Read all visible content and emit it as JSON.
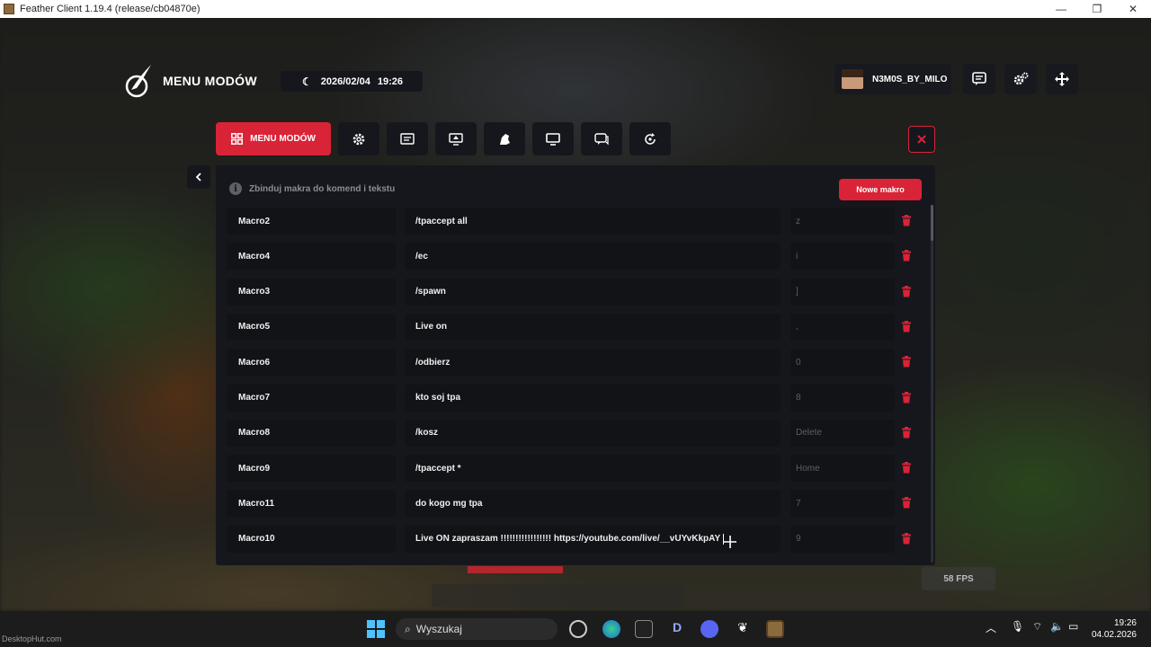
{
  "window": {
    "title": "Feather Client 1.19.4 (release/cb04870e)",
    "minimize": "—",
    "maximize": "❐",
    "close": "✕"
  },
  "header": {
    "brand": "MENU MODÓW",
    "date": "2026/02/04",
    "time": "19:26",
    "username": "N3M0S_BY_MILO"
  },
  "tabs": {
    "main_label": "MENU MODÓW",
    "icons": [
      "gear-icon",
      "text-icon",
      "screen-share-icon",
      "cosmetics-icon",
      "monitor-icon",
      "chat-icon",
      "refresh-icon"
    ]
  },
  "panel": {
    "info_text": "Zbinduj makra do komend i tekstu",
    "new_button": "Nowe makro",
    "macros": [
      {
        "name": "Macro2",
        "command": "/tpaccept all",
        "key": "z"
      },
      {
        "name": "Macro4",
        "command": "/ec",
        "key": "i"
      },
      {
        "name": "Macro3",
        "command": "/spawn",
        "key": "]"
      },
      {
        "name": "Macro5",
        "command": "Live on",
        "key": ","
      },
      {
        "name": "Macro6",
        "command": "/odbierz",
        "key": "0"
      },
      {
        "name": "Macro7",
        "command": "kto soj tpa",
        "key": "8"
      },
      {
        "name": "Macro8",
        "command": "/kosz",
        "key": "Delete"
      },
      {
        "name": "Macro9",
        "command": "/tpaccept *",
        "key": "Home"
      },
      {
        "name": "Macro11",
        "command": "do kogo mg tpa",
        "key": "7"
      },
      {
        "name": "Macro10",
        "command": "Live ON zapraszam !!!!!!!!!!!!!!!!! https://youtube.com/live/__vUYvKkpAY",
        "key": "9"
      }
    ]
  },
  "game_hud": {
    "fps": "58 FPS"
  },
  "taskbar": {
    "search_label": "Wyszukaj",
    "time": "19:26",
    "date": "04.02.2026"
  },
  "watermark": "DesktopHut.com",
  "colors": {
    "accent": "#d92337",
    "panel_bg": "#15171c",
    "cell_bg": "#111317"
  }
}
